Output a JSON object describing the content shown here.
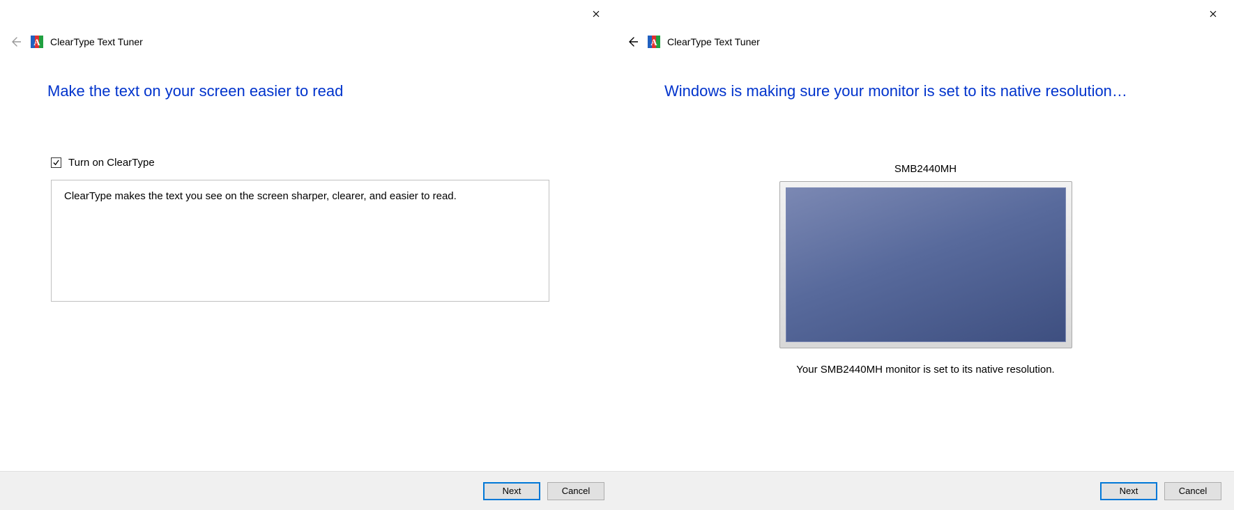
{
  "app": {
    "title": "ClearType Text Tuner"
  },
  "page1": {
    "heading": "Make the text on your screen easier to read",
    "checkbox": {
      "label": "Turn on ClearType",
      "checked": true
    },
    "description": "ClearType makes the text you see on the screen sharper, clearer, and easier to read.",
    "buttons": {
      "next": "Next",
      "cancel": "Cancel"
    }
  },
  "page2": {
    "heading": "Windows is making sure your monitor is set to its native resolution…",
    "monitor_name": "SMB2440MH",
    "status": "Your SMB2440MH monitor is set to its native resolution.",
    "buttons": {
      "next": "Next",
      "cancel": "Cancel"
    }
  }
}
